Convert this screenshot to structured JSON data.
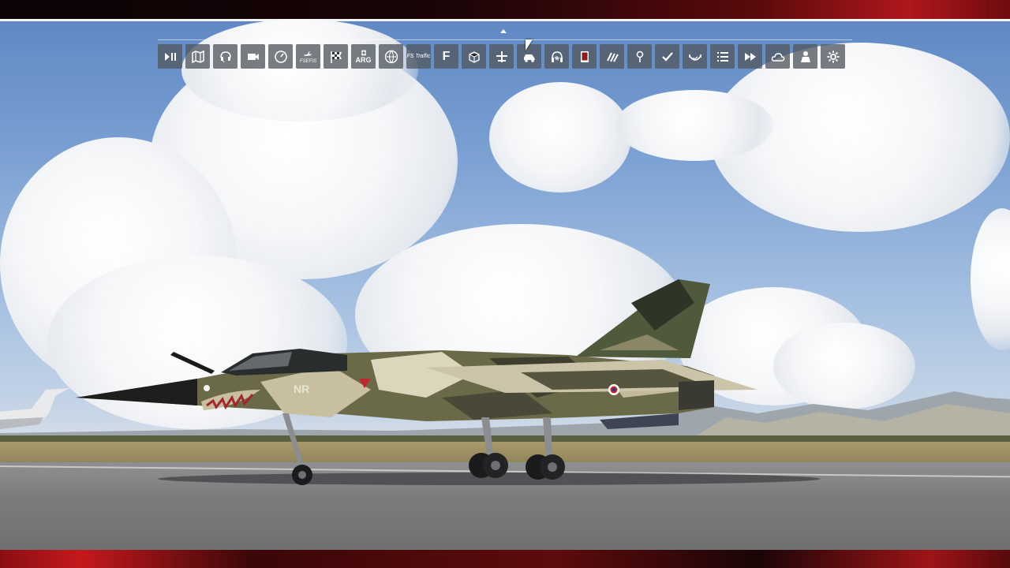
{
  "aircraft": {
    "tail_code": "NR"
  },
  "toolbar": {
    "buttons": [
      {
        "id": "pause-play",
        "icon": "pause-play-icon"
      },
      {
        "id": "map",
        "icon": "map-icon"
      },
      {
        "id": "atc",
        "icon": "headset-icon"
      },
      {
        "id": "camera",
        "icon": "camera-icon"
      },
      {
        "id": "checklist-gauge",
        "icon": "gauge-icon"
      },
      {
        "id": "addon-aircraft",
        "icon": "aircraft-icon",
        "label": "FSEFIS"
      },
      {
        "id": "race",
        "icon": "checkered-flag-icon"
      },
      {
        "id": "arg",
        "icon": "arg-icon",
        "label": "ARG"
      },
      {
        "id": "addon-globe",
        "icon": "globe-icon"
      },
      {
        "id": "fs-traffic",
        "icon": "traffic-icon",
        "label": "FS Traffic"
      },
      {
        "id": "ff",
        "icon": "ff-logo-icon",
        "label": "F"
      },
      {
        "id": "tool-box",
        "icon": "box-icon"
      },
      {
        "id": "ground-services",
        "icon": "ground-services-icon"
      },
      {
        "id": "vehicles",
        "icon": "vehicle-icon"
      },
      {
        "id": "audio",
        "icon": "headphones-icon"
      },
      {
        "id": "tablet",
        "icon": "tablet-icon"
      },
      {
        "id": "wind",
        "icon": "wind-icon"
      },
      {
        "id": "pin",
        "icon": "pin-icon"
      },
      {
        "id": "objectives",
        "icon": "check-icon"
      },
      {
        "id": "weather-radar",
        "icon": "radar-icon"
      },
      {
        "id": "list",
        "icon": "list-icon"
      },
      {
        "id": "sim-rate",
        "icon": "fast-forward-icon"
      },
      {
        "id": "weather",
        "icon": "cloud-icon"
      },
      {
        "id": "multiplayer",
        "icon": "person-icon"
      },
      {
        "id": "settings",
        "icon": "gear-icon"
      }
    ]
  }
}
